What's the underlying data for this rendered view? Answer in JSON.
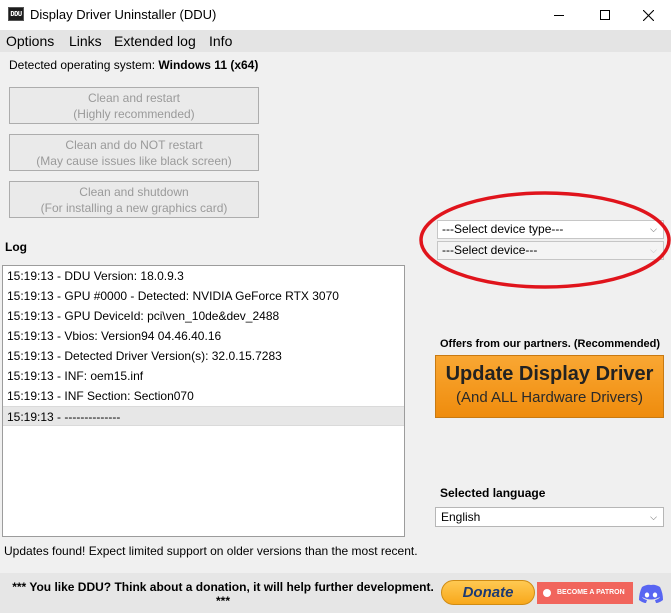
{
  "window": {
    "title": "Display Driver Uninstaller (DDU)",
    "icon_text": "DDU"
  },
  "menu": [
    "Options",
    "Links",
    "Extended log",
    "Info"
  ],
  "os": {
    "label": "Detected operating system:",
    "value": "Windows 11 (x64)"
  },
  "actions": [
    {
      "line1": "Clean and restart",
      "line2": "(Highly recommended)"
    },
    {
      "line1": "Clean and do NOT restart",
      "line2": "(May cause issues like black screen)"
    },
    {
      "line1": "Clean and shutdown",
      "line2": "(For installing a new graphics card)"
    }
  ],
  "log": {
    "label": "Log",
    "rows": [
      "15:19:13 - DDU Version: 18.0.9.3",
      "15:19:13 - GPU #0000 - Detected: NVIDIA GeForce RTX 3070",
      "15:19:13 - GPU DeviceId: pci\\ven_10de&dev_2488",
      "15:19:13 - Vbios: Version94 04.46.40.16",
      "15:19:13 - Detected Driver Version(s): 32.0.15.7283",
      "15:19:13 - INF: oem15.inf",
      "15:19:13 - INF Section: Section070",
      "15:19:13 - --------------"
    ]
  },
  "device_type_select": {
    "value": "---Select device type---"
  },
  "device_select": {
    "value": "---Select device---"
  },
  "partners": {
    "label": "Offers from our partners. (Recommended)",
    "update_line1": "Update Display Driver",
    "update_line2": "(And ALL Hardware Drivers)"
  },
  "language": {
    "label": "Selected language",
    "value": "English"
  },
  "status": "Updates found! Expect limited support on older versions than the most recent.",
  "footer": {
    "text": "*** You like DDU? Think about a donation, it will help further development. ***",
    "donate_label": "Donate",
    "patron_label": "BECOME A PATRON"
  },
  "colors": {
    "annotation": "#e0141c",
    "update_button": "#f39a1f",
    "patreon": "#f1655c",
    "discord": "#5865f2"
  }
}
